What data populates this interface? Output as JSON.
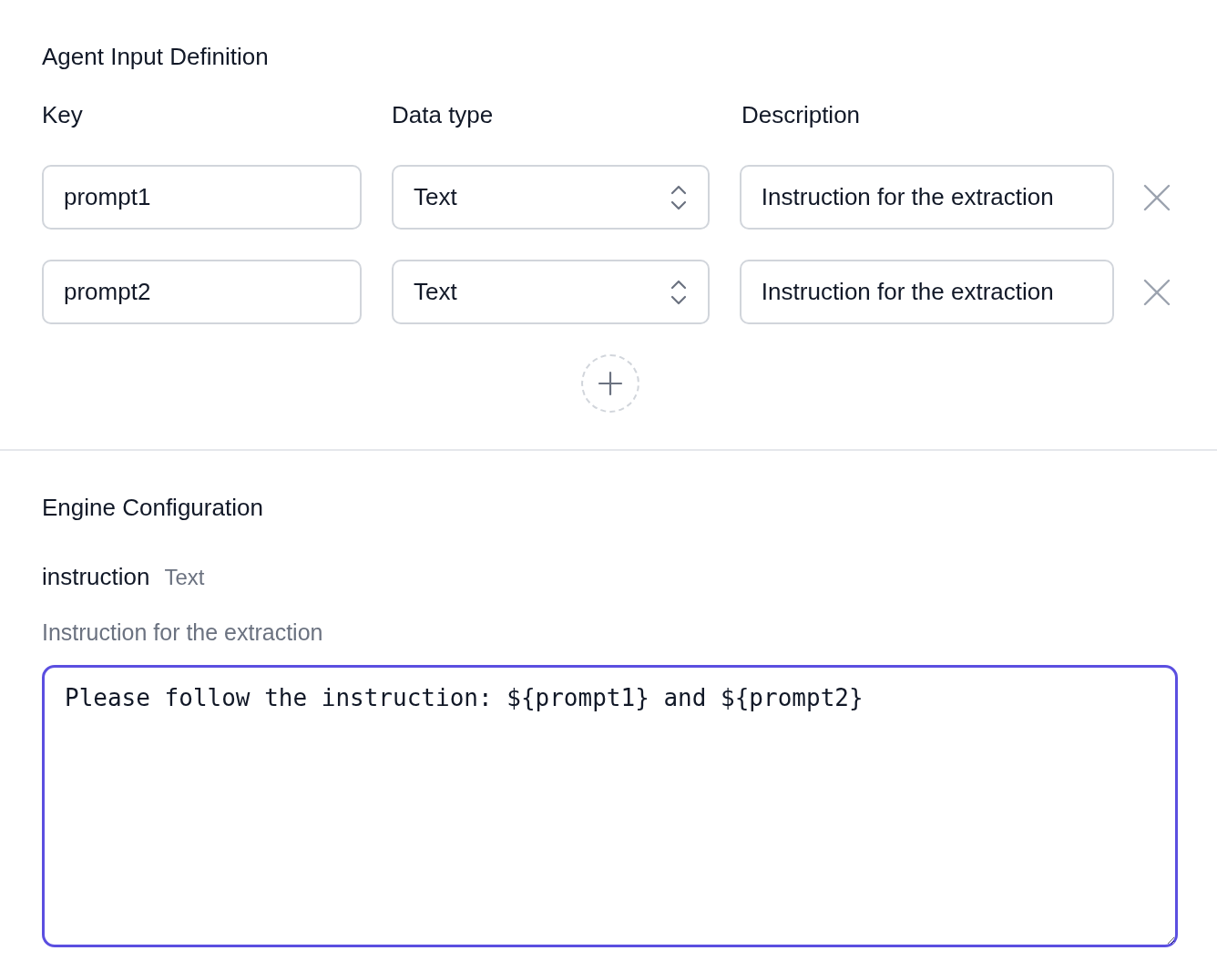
{
  "input_definition": {
    "title": "Agent Input Definition",
    "columns": [
      "Key",
      "Data type",
      "Description"
    ],
    "rows": [
      {
        "key": "prompt1",
        "data_type": "Text",
        "description": "Instruction for the extraction"
      },
      {
        "key": "prompt2",
        "data_type": "Text",
        "description": "Instruction for the extraction"
      }
    ]
  },
  "engine_configuration": {
    "title": "Engine Configuration",
    "field": {
      "name": "instruction",
      "type": "Text",
      "description": "Instruction for the extraction",
      "value": "Please follow the instruction: ${prompt1} and ${prompt2}"
    }
  }
}
